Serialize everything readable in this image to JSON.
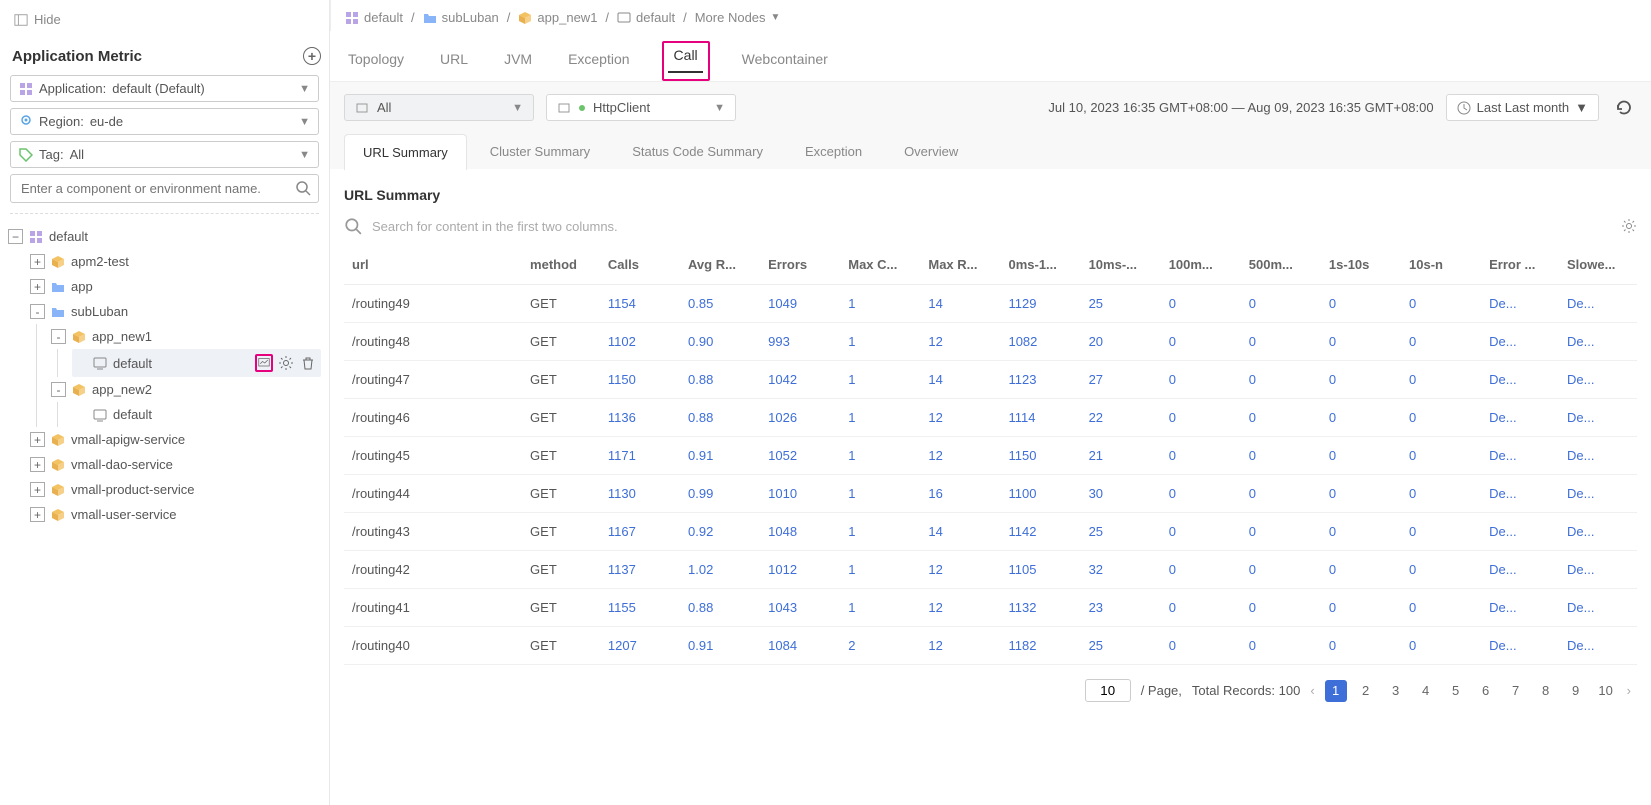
{
  "sidebar": {
    "hide_label": "Hide",
    "section_title": "Application Metric",
    "application_label": "Application:",
    "application_value": "default (Default)",
    "region_label": "Region:",
    "region_value": "eu-de",
    "tag_label": "Tag:",
    "tag_value": "All",
    "search_placeholder": "Enter a component or environment name.",
    "tree": {
      "root": "default",
      "items": [
        {
          "label": "apm2-test",
          "expand": "+"
        },
        {
          "label": "app",
          "expand": "+"
        },
        {
          "label": "subLuban",
          "expand": "-",
          "children": [
            {
              "label": "app_new1",
              "expand": "-",
              "children": [
                {
                  "label": "default",
                  "selected": true
                }
              ]
            },
            {
              "label": "app_new2",
              "expand": "-",
              "children": [
                {
                  "label": "default"
                }
              ]
            }
          ]
        },
        {
          "label": "vmall-apigw-service",
          "expand": "+"
        },
        {
          "label": "vmall-dao-service",
          "expand": "+"
        },
        {
          "label": "vmall-product-service",
          "expand": "+"
        },
        {
          "label": "vmall-user-service",
          "expand": "+"
        }
      ]
    }
  },
  "breadcrumb": {
    "items": [
      "default",
      "subLuban",
      "app_new1",
      "default",
      "More Nodes"
    ]
  },
  "main_tabs": [
    "Topology",
    "URL",
    "JVM",
    "Exception",
    "Call",
    "Webcontainer"
  ],
  "active_main_tab": "Call",
  "filters": {
    "select_all": "All",
    "select_client": "HttpClient",
    "time_range": "Jul 10, 2023 16:35 GMT+08:00 — Aug 09, 2023 16:35 GMT+08:00",
    "time_label": "Last Last month"
  },
  "subtabs": [
    "URL Summary",
    "Cluster Summary",
    "Status Code Summary",
    "Exception",
    "Overview"
  ],
  "active_subtab": "URL Summary",
  "panel": {
    "title": "URL Summary",
    "search_placeholder": "Search for content in the first two columns."
  },
  "table": {
    "headers": [
      "url",
      "method",
      "Calls",
      "Avg R...",
      "Errors",
      "Max C...",
      "Max R...",
      "0ms-1...",
      "10ms-...",
      "100m...",
      "500m...",
      "1s-10s",
      "10s-n",
      "Error ...",
      "Slowe..."
    ],
    "rows": [
      {
        "url": "/routing49",
        "method": "GET",
        "calls": "1154",
        "avg": "0.85",
        "errors": "1049",
        "maxc": "1",
        "maxr": "14",
        "b0": "1129",
        "b10": "25",
        "b100": "0",
        "b500": "0",
        "s1": "0",
        "s10": "0",
        "err": "De...",
        "slow": "De..."
      },
      {
        "url": "/routing48",
        "method": "GET",
        "calls": "1102",
        "avg": "0.90",
        "errors": "993",
        "maxc": "1",
        "maxr": "12",
        "b0": "1082",
        "b10": "20",
        "b100": "0",
        "b500": "0",
        "s1": "0",
        "s10": "0",
        "err": "De...",
        "slow": "De..."
      },
      {
        "url": "/routing47",
        "method": "GET",
        "calls": "1150",
        "avg": "0.88",
        "errors": "1042",
        "maxc": "1",
        "maxr": "14",
        "b0": "1123",
        "b10": "27",
        "b100": "0",
        "b500": "0",
        "s1": "0",
        "s10": "0",
        "err": "De...",
        "slow": "De..."
      },
      {
        "url": "/routing46",
        "method": "GET",
        "calls": "1136",
        "avg": "0.88",
        "errors": "1026",
        "maxc": "1",
        "maxr": "12",
        "b0": "1114",
        "b10": "22",
        "b100": "0",
        "b500": "0",
        "s1": "0",
        "s10": "0",
        "err": "De...",
        "slow": "De..."
      },
      {
        "url": "/routing45",
        "method": "GET",
        "calls": "1171",
        "avg": "0.91",
        "errors": "1052",
        "maxc": "1",
        "maxr": "12",
        "b0": "1150",
        "b10": "21",
        "b100": "0",
        "b500": "0",
        "s1": "0",
        "s10": "0",
        "err": "De...",
        "slow": "De..."
      },
      {
        "url": "/routing44",
        "method": "GET",
        "calls": "1130",
        "avg": "0.99",
        "errors": "1010",
        "maxc": "1",
        "maxr": "16",
        "b0": "1100",
        "b10": "30",
        "b100": "0",
        "b500": "0",
        "s1": "0",
        "s10": "0",
        "err": "De...",
        "slow": "De..."
      },
      {
        "url": "/routing43",
        "method": "GET",
        "calls": "1167",
        "avg": "0.92",
        "errors": "1048",
        "maxc": "1",
        "maxr": "14",
        "b0": "1142",
        "b10": "25",
        "b100": "0",
        "b500": "0",
        "s1": "0",
        "s10": "0",
        "err": "De...",
        "slow": "De..."
      },
      {
        "url": "/routing42",
        "method": "GET",
        "calls": "1137",
        "avg": "1.02",
        "errors": "1012",
        "maxc": "1",
        "maxr": "12",
        "b0": "1105",
        "b10": "32",
        "b100": "0",
        "b500": "0",
        "s1": "0",
        "s10": "0",
        "err": "De...",
        "slow": "De..."
      },
      {
        "url": "/routing41",
        "method": "GET",
        "calls": "1155",
        "avg": "0.88",
        "errors": "1043",
        "maxc": "1",
        "maxr": "12",
        "b0": "1132",
        "b10": "23",
        "b100": "0",
        "b500": "0",
        "s1": "0",
        "s10": "0",
        "err": "De...",
        "slow": "De..."
      },
      {
        "url": "/routing40",
        "method": "GET",
        "calls": "1207",
        "avg": "0.91",
        "errors": "1084",
        "maxc": "2",
        "maxr": "12",
        "b0": "1182",
        "b10": "25",
        "b100": "0",
        "b500": "0",
        "s1": "0",
        "s10": "0",
        "err": "De...",
        "slow": "De..."
      }
    ]
  },
  "pagination": {
    "page_size": "10",
    "per_page_label": "/ Page,",
    "total_label": "Total Records: 100",
    "pages": [
      "1",
      "2",
      "3",
      "4",
      "5",
      "6",
      "7",
      "8",
      "9",
      "10"
    ],
    "active": "1"
  }
}
